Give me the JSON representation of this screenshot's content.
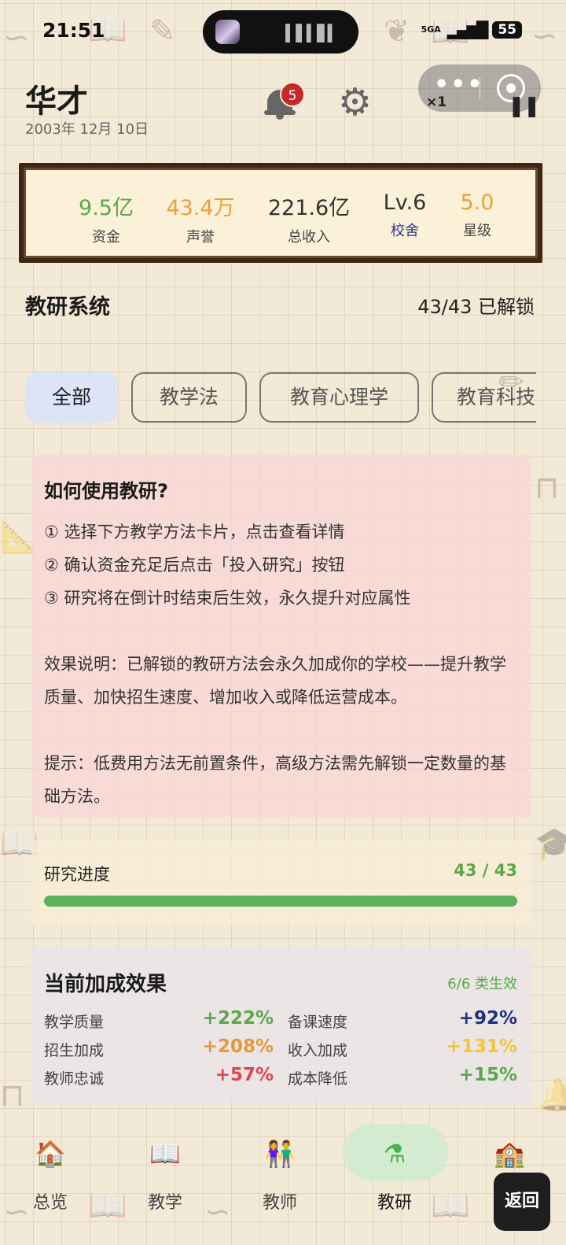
{
  "status_bar": {
    "time": "21:51",
    "network": "5GA",
    "battery": "55"
  },
  "header": {
    "school_name": "华才",
    "date": "2003年 12月 10日",
    "notification_count": "5",
    "speed": "×1"
  },
  "stats": [
    {
      "value": "9.5亿",
      "label": "资金",
      "value_color": "#5aa84a",
      "label_color": "#444444"
    },
    {
      "value": "43.4万",
      "label": "声誉",
      "value_color": "#e8a23a",
      "label_color": "#444444"
    },
    {
      "value": "221.6亿",
      "label": "总收入",
      "value_color": "#333333",
      "label_color": "#444444"
    },
    {
      "value": "Lv.6",
      "label": "校舍",
      "value_color": "#333333",
      "label_color": "#2a3a8c"
    },
    {
      "value": "5.0",
      "label": "星级",
      "value_color": "#e8a23a",
      "label_color": "#444444"
    }
  ],
  "section": {
    "title": "教研系统",
    "unlocked": "43/43 已解锁"
  },
  "tabs": [
    {
      "label": "全部",
      "active": true
    },
    {
      "label": "教学法",
      "active": false
    },
    {
      "label": "教育心理学",
      "active": false
    },
    {
      "label": "教育科技",
      "active": false
    }
  ],
  "help": {
    "title": "如何使用教研?",
    "steps": [
      "① 选择下方教学方法卡片，点击查看详情",
      "② 确认资金充足后点击「投入研究」按钮",
      "③ 研究将在倒计时结束后生效，永久提升对应属性"
    ],
    "effect": "效果说明：已解锁的教研方法会永久加成你的学校——提升教学质量、加快招生速度、增加收入或降低运营成本。",
    "tip": "提示：低费用方法无前置条件，高级方法需先解锁一定数量的基础方法。"
  },
  "progress": {
    "label": "研究进度",
    "text": "43 / 43",
    "fraction": 1.0
  },
  "bonuses": {
    "title": "当前加成效果",
    "count": "6/6 类生效",
    "items": [
      {
        "label": "教学质量",
        "value": "+222%",
        "color": "#5aa84a"
      },
      {
        "label": "备课速度",
        "value": "+92%",
        "color": "#23307a"
      },
      {
        "label": "招生加成",
        "value": "+208%",
        "color": "#e8963a"
      },
      {
        "label": "收入加成",
        "value": "+131%",
        "color": "#f2c53a"
      },
      {
        "label": "教师忠诚",
        "value": "+57%",
        "color": "#e0454a"
      },
      {
        "label": "成本降低",
        "value": "+15%",
        "color": "#5aa84a"
      }
    ]
  },
  "nav": [
    {
      "label": "总览",
      "icon": "school-building-icon",
      "glyph": "🏠",
      "active": false
    },
    {
      "label": "教学",
      "icon": "book-icon",
      "glyph": "📖",
      "active": false
    },
    {
      "label": "教师",
      "icon": "teachers-icon",
      "glyph": "👫",
      "active": false
    },
    {
      "label": "教研",
      "icon": "flask-icon",
      "glyph": "⚗",
      "active": true
    },
    {
      "label": "",
      "icon": "academy-icon",
      "glyph": "🏫",
      "active": false
    }
  ],
  "back_button": "返回"
}
